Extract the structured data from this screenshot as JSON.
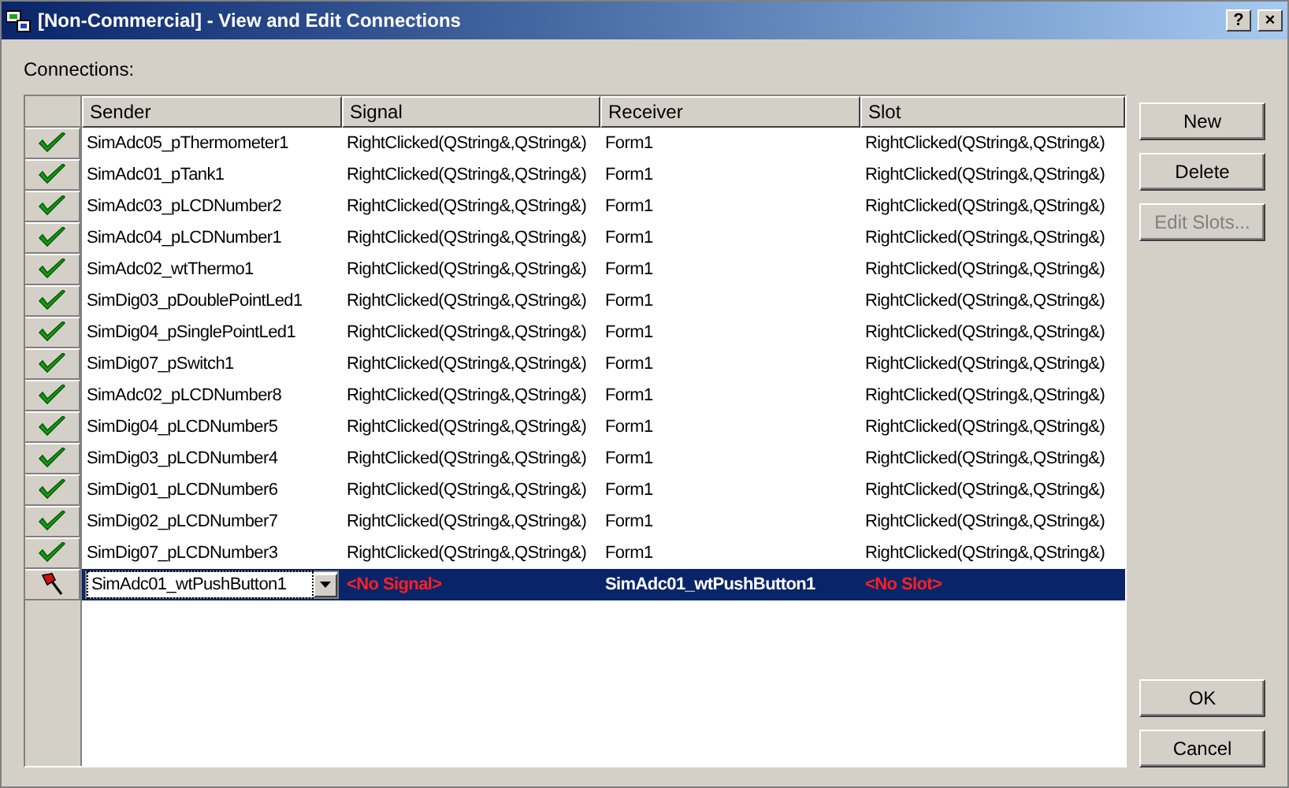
{
  "window": {
    "title": "[Non-Commercial] - View and Edit Connections",
    "title_buttons": [
      "?",
      "×"
    ]
  },
  "connections_label": "Connections:",
  "table": {
    "columns": [
      "Sender",
      "Signal",
      "Receiver",
      "Slot"
    ],
    "rows": [
      {
        "kind": "connected",
        "selected": false,
        "cells": [
          "SimAdc05_pThermometer1",
          "RightClicked(QString&,QString&)",
          "Form1",
          "RightClicked(QString&,QString&)"
        ]
      },
      {
        "kind": "connected",
        "selected": false,
        "cells": [
          "SimAdc01_pTank1",
          "RightClicked(QString&,QString&)",
          "Form1",
          "RightClicked(QString&,QString&)"
        ]
      },
      {
        "kind": "connected",
        "selected": false,
        "cells": [
          "SimAdc03_pLCDNumber2",
          "RightClicked(QString&,QString&)",
          "Form1",
          "RightClicked(QString&,QString&)"
        ]
      },
      {
        "kind": "connected",
        "selected": false,
        "cells": [
          "SimAdc04_pLCDNumber1",
          "RightClicked(QString&,QString&)",
          "Form1",
          "RightClicked(QString&,QString&)"
        ]
      },
      {
        "kind": "connected",
        "selected": false,
        "cells": [
          "SimAdc02_wtThermo1",
          "RightClicked(QString&,QString&)",
          "Form1",
          "RightClicked(QString&,QString&)"
        ]
      },
      {
        "kind": "connected",
        "selected": false,
        "cells": [
          "SimDig03_pDoublePointLed1",
          "RightClicked(QString&,QString&)",
          "Form1",
          "RightClicked(QString&,QString&)"
        ]
      },
      {
        "kind": "connected",
        "selected": false,
        "cells": [
          "SimDig04_pSinglePointLed1",
          "RightClicked(QString&,QString&)",
          "Form1",
          "RightClicked(QString&,QString&)"
        ]
      },
      {
        "kind": "connected",
        "selected": false,
        "cells": [
          "SimDig07_pSwitch1",
          "RightClicked(QString&,QString&)",
          "Form1",
          "RightClicked(QString&,QString&)"
        ]
      },
      {
        "kind": "connected",
        "selected": false,
        "cells": [
          "SimAdc02_pLCDNumber8",
          "RightClicked(QString&,QString&)",
          "Form1",
          "RightClicked(QString&,QString&)"
        ]
      },
      {
        "kind": "connected",
        "selected": false,
        "cells": [
          "SimDig04_pLCDNumber5",
          "RightClicked(QString&,QString&)",
          "Form1",
          "RightClicked(QString&,QString&)"
        ]
      },
      {
        "kind": "connected",
        "selected": false,
        "cells": [
          "SimDig03_pLCDNumber4",
          "RightClicked(QString&,QString&)",
          "Form1",
          "RightClicked(QString&,QString&)"
        ]
      },
      {
        "kind": "connected",
        "selected": false,
        "cells": [
          "SimDig01_pLCDNumber6",
          "RightClicked(QString&,QString&)",
          "Form1",
          "RightClicked(QString&,QString&)"
        ]
      },
      {
        "kind": "connected",
        "selected": false,
        "cells": [
          "SimDig02_pLCDNumber7",
          "RightClicked(QString&,QString&)",
          "Form1",
          "RightClicked(QString&,QString&)"
        ]
      },
      {
        "kind": "connected",
        "selected": false,
        "cells": [
          "SimDig07_pLCDNumber3",
          "RightClicked(QString&,QString&)",
          "Form1",
          "RightClicked(QString&,QString&)"
        ]
      },
      {
        "kind": "pending",
        "selected": true,
        "cells": [
          "SimAdc01_wtPushButton1",
          "<No Signal>",
          "SimAdc01_wtPushButton1",
          "<No Slot>"
        ]
      }
    ]
  },
  "side_buttons": [
    {
      "label": "New",
      "disabled": false
    },
    {
      "label": "Delete",
      "disabled": false
    },
    {
      "label": "Edit Slots...",
      "disabled": true
    }
  ],
  "dialog_buttons": [
    {
      "label": "OK",
      "disabled": false
    },
    {
      "label": "Cancel",
      "disabled": false
    }
  ]
}
